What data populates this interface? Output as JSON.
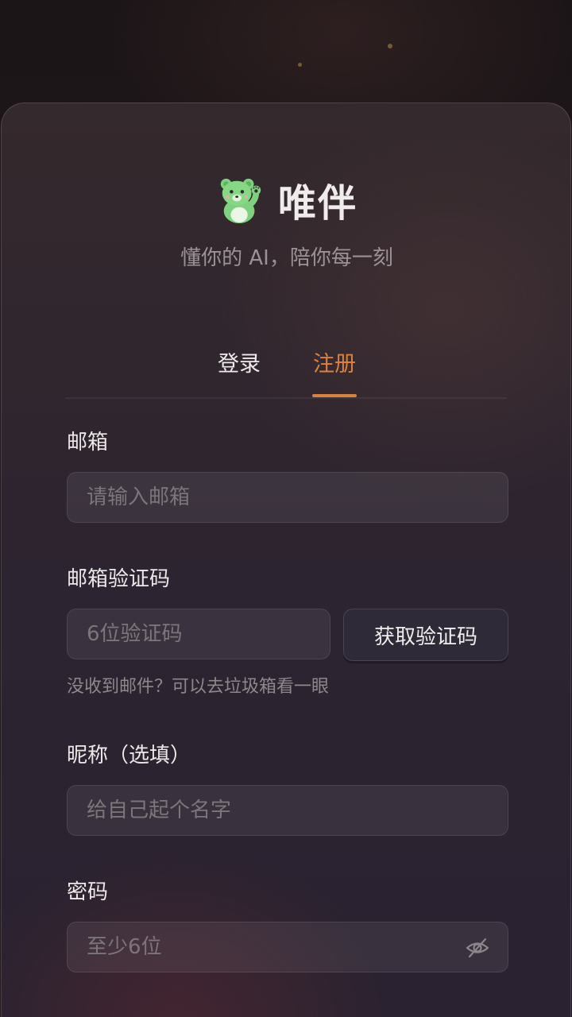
{
  "brand": {
    "app_name": "唯伴",
    "tagline": "懂你的 AI，陪你每一刻",
    "logo_icon": "green-bear-waving-icon"
  },
  "tabs": [
    {
      "label": "登录",
      "active": false
    },
    {
      "label": "注册",
      "active": true
    }
  ],
  "colors": {
    "accent": "#d9823f",
    "card_background": "#2d2430",
    "page_background": "#1b1518"
  },
  "form": {
    "email": {
      "label": "邮箱",
      "placeholder": "请输入邮箱",
      "value": ""
    },
    "code": {
      "label": "邮箱验证码",
      "placeholder": "6位验证码",
      "value": "",
      "button_label": "获取验证码",
      "hint": "没收到邮件？可以去垃圾箱看一眼"
    },
    "nickname": {
      "label": "昵称（选填）",
      "placeholder": "给自己起个名字",
      "value": ""
    },
    "password": {
      "label": "密码",
      "placeholder": "至少6位",
      "value": "",
      "toggle_icon": "eye-off-icon"
    }
  }
}
